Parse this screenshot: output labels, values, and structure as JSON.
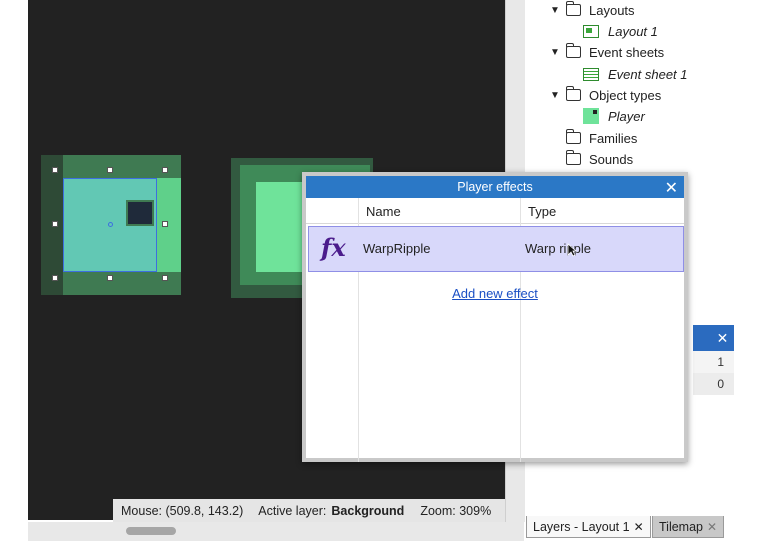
{
  "tree": {
    "layouts": "Layouts",
    "layout1": "Layout 1",
    "event_sheets": "Event sheets",
    "event_sheet1": "Event sheet 1",
    "object_types": "Object types",
    "player": "Player",
    "families": "Families",
    "sounds": "Sounds"
  },
  "status": {
    "mouse": "Mouse: (509.8, 143.2)",
    "active_layer_label": "Active layer:",
    "active_layer_value": "Background",
    "zoom": "Zoom: 309%"
  },
  "dialog": {
    "title": "Player effects",
    "close": "✕",
    "col_name": "Name",
    "col_type": "Type",
    "effects": [
      {
        "icon": "fx",
        "name": "WarpRipple",
        "type": "Warp ripple"
      }
    ],
    "add_link": "Add new effect"
  },
  "mini_panel": {
    "close": "✕",
    "values": [
      "1",
      "0"
    ]
  },
  "tabs": {
    "tab1_label": "Layers - Layout 1",
    "tab1_close": "✕",
    "tab2_label": "Tilemap",
    "tab2_close": "✕"
  },
  "icons": {
    "folder": "folder-icon",
    "layout": "layout-icon",
    "event_sheet": "event-sheet-icon",
    "sprite": "sprite-icon",
    "expand": "triangle-down-icon",
    "fx": "fx-icon"
  },
  "colors": {
    "canvas_bg": "#222222",
    "dialog_title": "#2b78c6",
    "selected_row": "#d8d8fa",
    "link": "#1a4fc4",
    "sprite_green": "#6fe39a"
  }
}
